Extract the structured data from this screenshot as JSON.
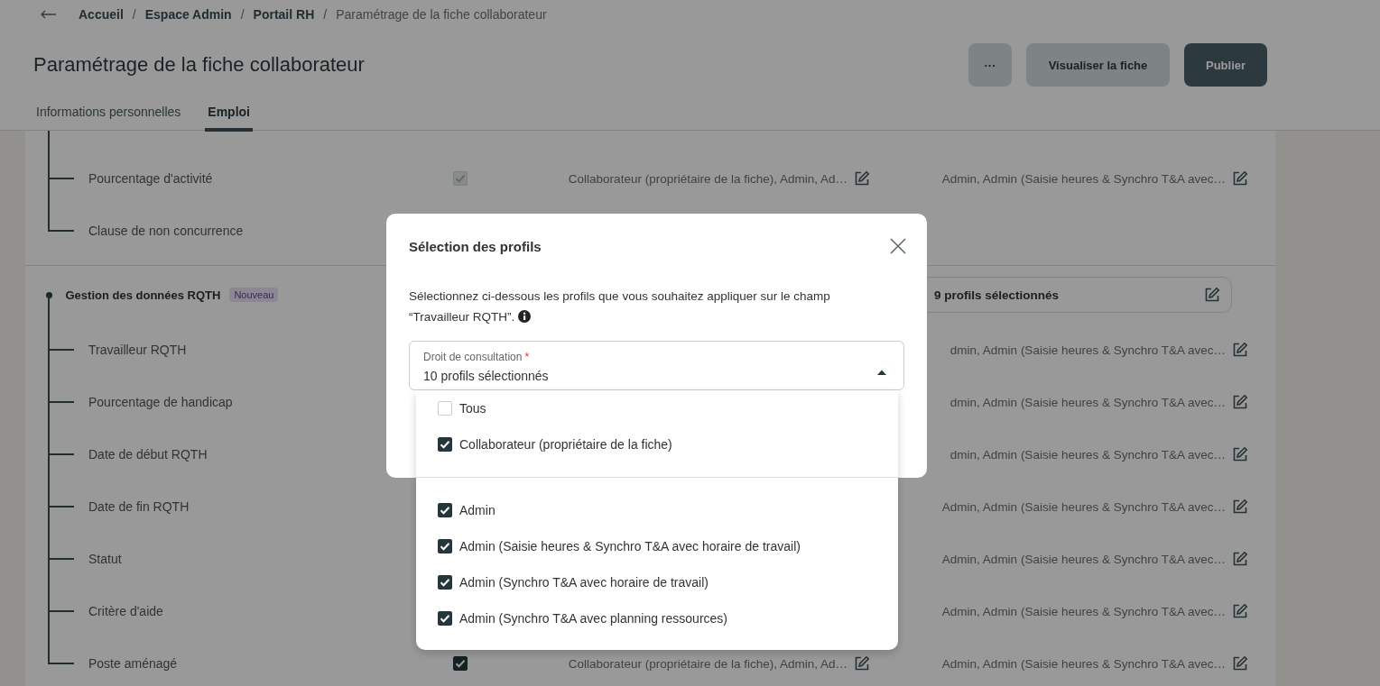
{
  "breadcrumb": {
    "separator": "/",
    "items": [
      "Accueil",
      "Espace Admin",
      "Portail RH",
      "Paramétrage de la fiche collaborateur"
    ]
  },
  "page_title": "Paramétrage de la fiche collaborateur",
  "actions": [
    {
      "label": "···",
      "kind": "more"
    },
    {
      "label": "Visualiser la fiche",
      "kind": "secondary"
    },
    {
      "label": "Publier",
      "kind": "primary"
    }
  ],
  "tabs": [
    {
      "label": "Informations personnelles",
      "selected": false
    },
    {
      "label": "Emploi",
      "selected": true
    }
  ],
  "sections": [
    {
      "rows": [
        {
          "label": "Pourcentage d'activité",
          "checkbox": {
            "checked": true,
            "disabled": true
          },
          "column_3": "Collaborateur (propriétaire de la fiche), Admin, Ad…",
          "column_4": "Admin, Admin (Saisie heures & Synchro T&A avec…"
        },
        {
          "label": "Clause de non concurrence"
        }
      ]
    },
    {
      "title": "Gestion des données RQTH",
      "badge": "Nouveau",
      "summary": "9 profils sélectionnés",
      "rows": [
        {
          "label": "Travailleur RQTH",
          "column_4": "dmin, Admin (Saisie heures & Synchro T&A avec…"
        },
        {
          "label": "Pourcentage de handicap",
          "column_4": "dmin, Admin (Saisie heures & Synchro T&A avec…"
        },
        {
          "label": "Date de début RQTH",
          "column_4": "dmin, Admin (Saisie heures & Synchro T&A avec…"
        },
        {
          "label": "Date de fin RQTH",
          "column_4": "Admin, Admin (Saisie heures & Synchro T&A avec…"
        },
        {
          "label": "Statut",
          "column_4": "Admin, Admin (Saisie heures & Synchro T&A avec…"
        },
        {
          "label": "Critère d'aide",
          "column_4": "Admin, Admin (Saisie heures & Synchro T&A avec…"
        },
        {
          "label": "Poste aménagé",
          "checkbox": {
            "checked": true,
            "disabled": false
          },
          "column_3": "Collaborateur (propriétaire de la fiche), Admin, Ad…",
          "column_4": "Admin, Admin (Saisie heures & Synchro T&A avec…"
        }
      ]
    }
  ],
  "modal": {
    "title": "Sélection des profils",
    "description": "Sélectionnez ci-dessous les profils que vous souhaitez appliquer sur le champ “Travailleur RQTH”.",
    "select": {
      "label": "Droit de consultation",
      "required_mark": "*",
      "value": "10 profils sélectionnés",
      "expanded": true
    },
    "option_groups": [
      [
        {
          "label": "Tous",
          "checked": false
        },
        {
          "label": "Collaborateur (propriétaire de la fiche)",
          "checked": true
        }
      ],
      [
        {
          "label": "Admin",
          "checked": true
        },
        {
          "label": "Admin (Saisie heures & Synchro T&A avec horaire de travail)",
          "checked": true
        },
        {
          "label": "Admin (Synchro T&A avec horaire de travail)",
          "checked": true
        },
        {
          "label": "Admin (Synchro T&A avec planning ressources)",
          "checked": true
        }
      ]
    ]
  }
}
